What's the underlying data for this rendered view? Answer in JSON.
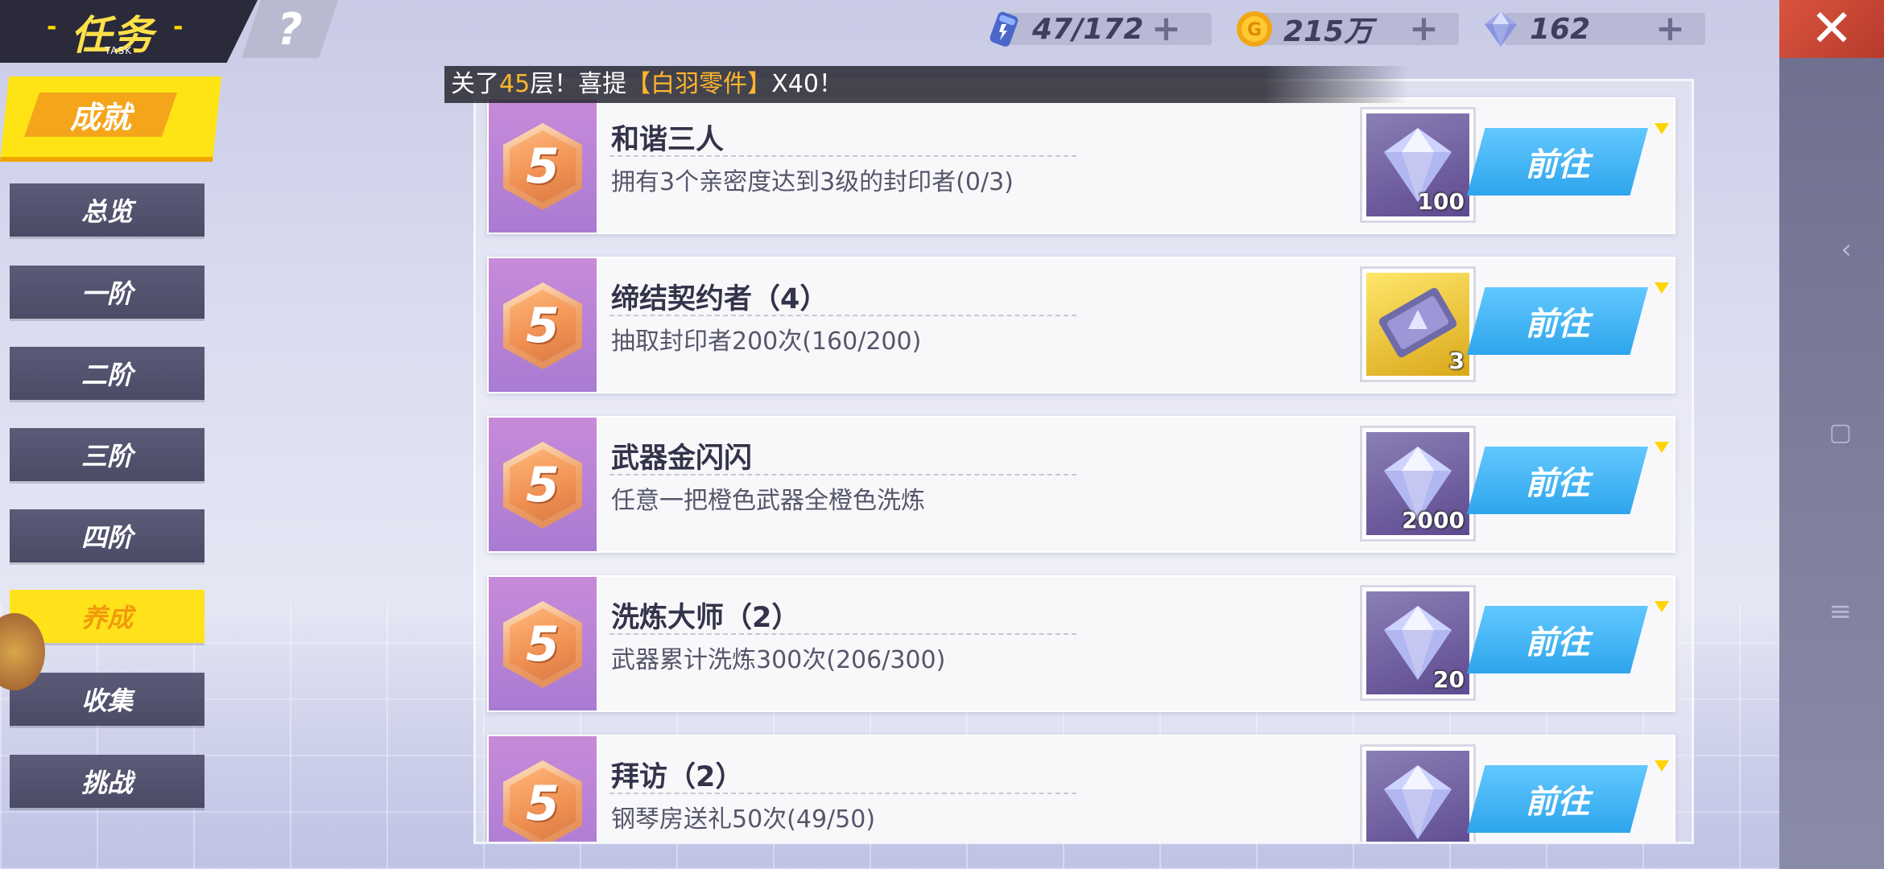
{
  "header": {
    "title": "任务",
    "subtitle": "TASK",
    "help": "?",
    "resources": [
      {
        "name": "stamina",
        "icon": "energy-can-icon",
        "value": "47/172"
      },
      {
        "name": "gold",
        "icon": "gold-coin-icon",
        "value": "215万"
      },
      {
        "name": "diamond",
        "icon": "diamond-icon",
        "value": "162"
      }
    ],
    "close_icon": "close-icon"
  },
  "sidebar": {
    "main_label": "成就",
    "items": [
      {
        "label": "总览"
      },
      {
        "label": "一阶"
      },
      {
        "label": "二阶"
      },
      {
        "label": "三阶"
      },
      {
        "label": "四阶"
      },
      {
        "label": "养成"
      },
      {
        "label": "收集"
      },
      {
        "label": "挑战"
      }
    ],
    "active_index": 5
  },
  "marquee": {
    "prefix": "关了",
    "number": "45",
    "middle": "层！喜提",
    "item": "【白羽零件】",
    "suffix": "X40！"
  },
  "tasks": [
    {
      "badge": "5",
      "title": "和谐三人",
      "desc": "拥有3个亲密度达到3级的封印者(0/3)",
      "reward_icon": "diamond-icon",
      "reward_qty": "100",
      "button": "前往"
    },
    {
      "badge": "5",
      "title": "缔结契约者（4）",
      "desc": "抽取封印者200次(160/200)",
      "reward_icon": "summon-ticket-icon",
      "reward_qty": "3",
      "button": "前往"
    },
    {
      "badge": "5",
      "title": "武器金闪闪",
      "desc": "任意一把橙色武器全橙色洗炼",
      "reward_icon": "diamond-icon",
      "reward_qty": "2000",
      "button": "前往"
    },
    {
      "badge": "5",
      "title": "洗炼大师（2）",
      "desc": "武器累计洗炼300次(206/300)",
      "reward_icon": "diamond-icon",
      "reward_qty": "20",
      "button": "前往"
    },
    {
      "badge": "5",
      "title": "拜访（2）",
      "desc": "钢琴房送礼50次(49/50)",
      "reward_icon": "diamond-icon",
      "reward_qty": "",
      "button": "前往"
    }
  ]
}
